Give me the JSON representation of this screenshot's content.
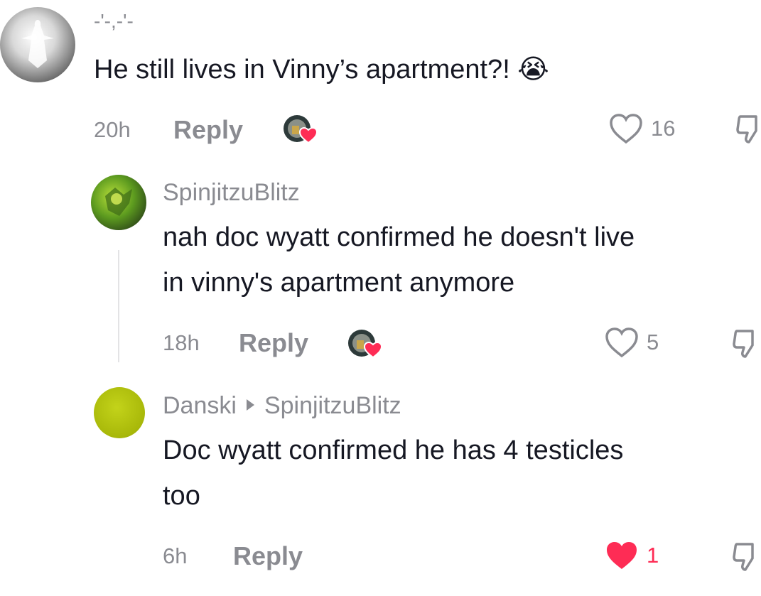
{
  "comments": [
    {
      "username": "-'-,-'-",
      "text_lines": [
        "He still lives in Vinny’s apartment?! 😭"
      ],
      "time": "20h",
      "reply_label": "Reply",
      "likes": "16",
      "liked": false
    },
    {
      "username": "SpinjitzuBlitz",
      "text_lines": [
        "nah doc wyatt confirmed he doesn't live",
        "in vinny's apartment anymore"
      ],
      "time": "18h",
      "reply_label": "Reply",
      "likes": "5",
      "liked": false
    },
    {
      "username": "Danski",
      "reply_to": "SpinjitzuBlitz",
      "text_lines": [
        "Doc wyatt confirmed he has 4 testicles",
        "too"
      ],
      "time": "6h",
      "reply_label": "Reply",
      "likes": "1",
      "liked": true
    }
  ],
  "colors": {
    "text": "#161823",
    "muted": "#8a8b91",
    "like_red": "#fe2c55",
    "avatar_green": "#b2c20a"
  },
  "icons": {
    "like": "heart-outline-icon",
    "liked": "heart-filled-icon",
    "dislike": "thumbs-down-icon",
    "creator": "creator-liked-badge-icon"
  }
}
